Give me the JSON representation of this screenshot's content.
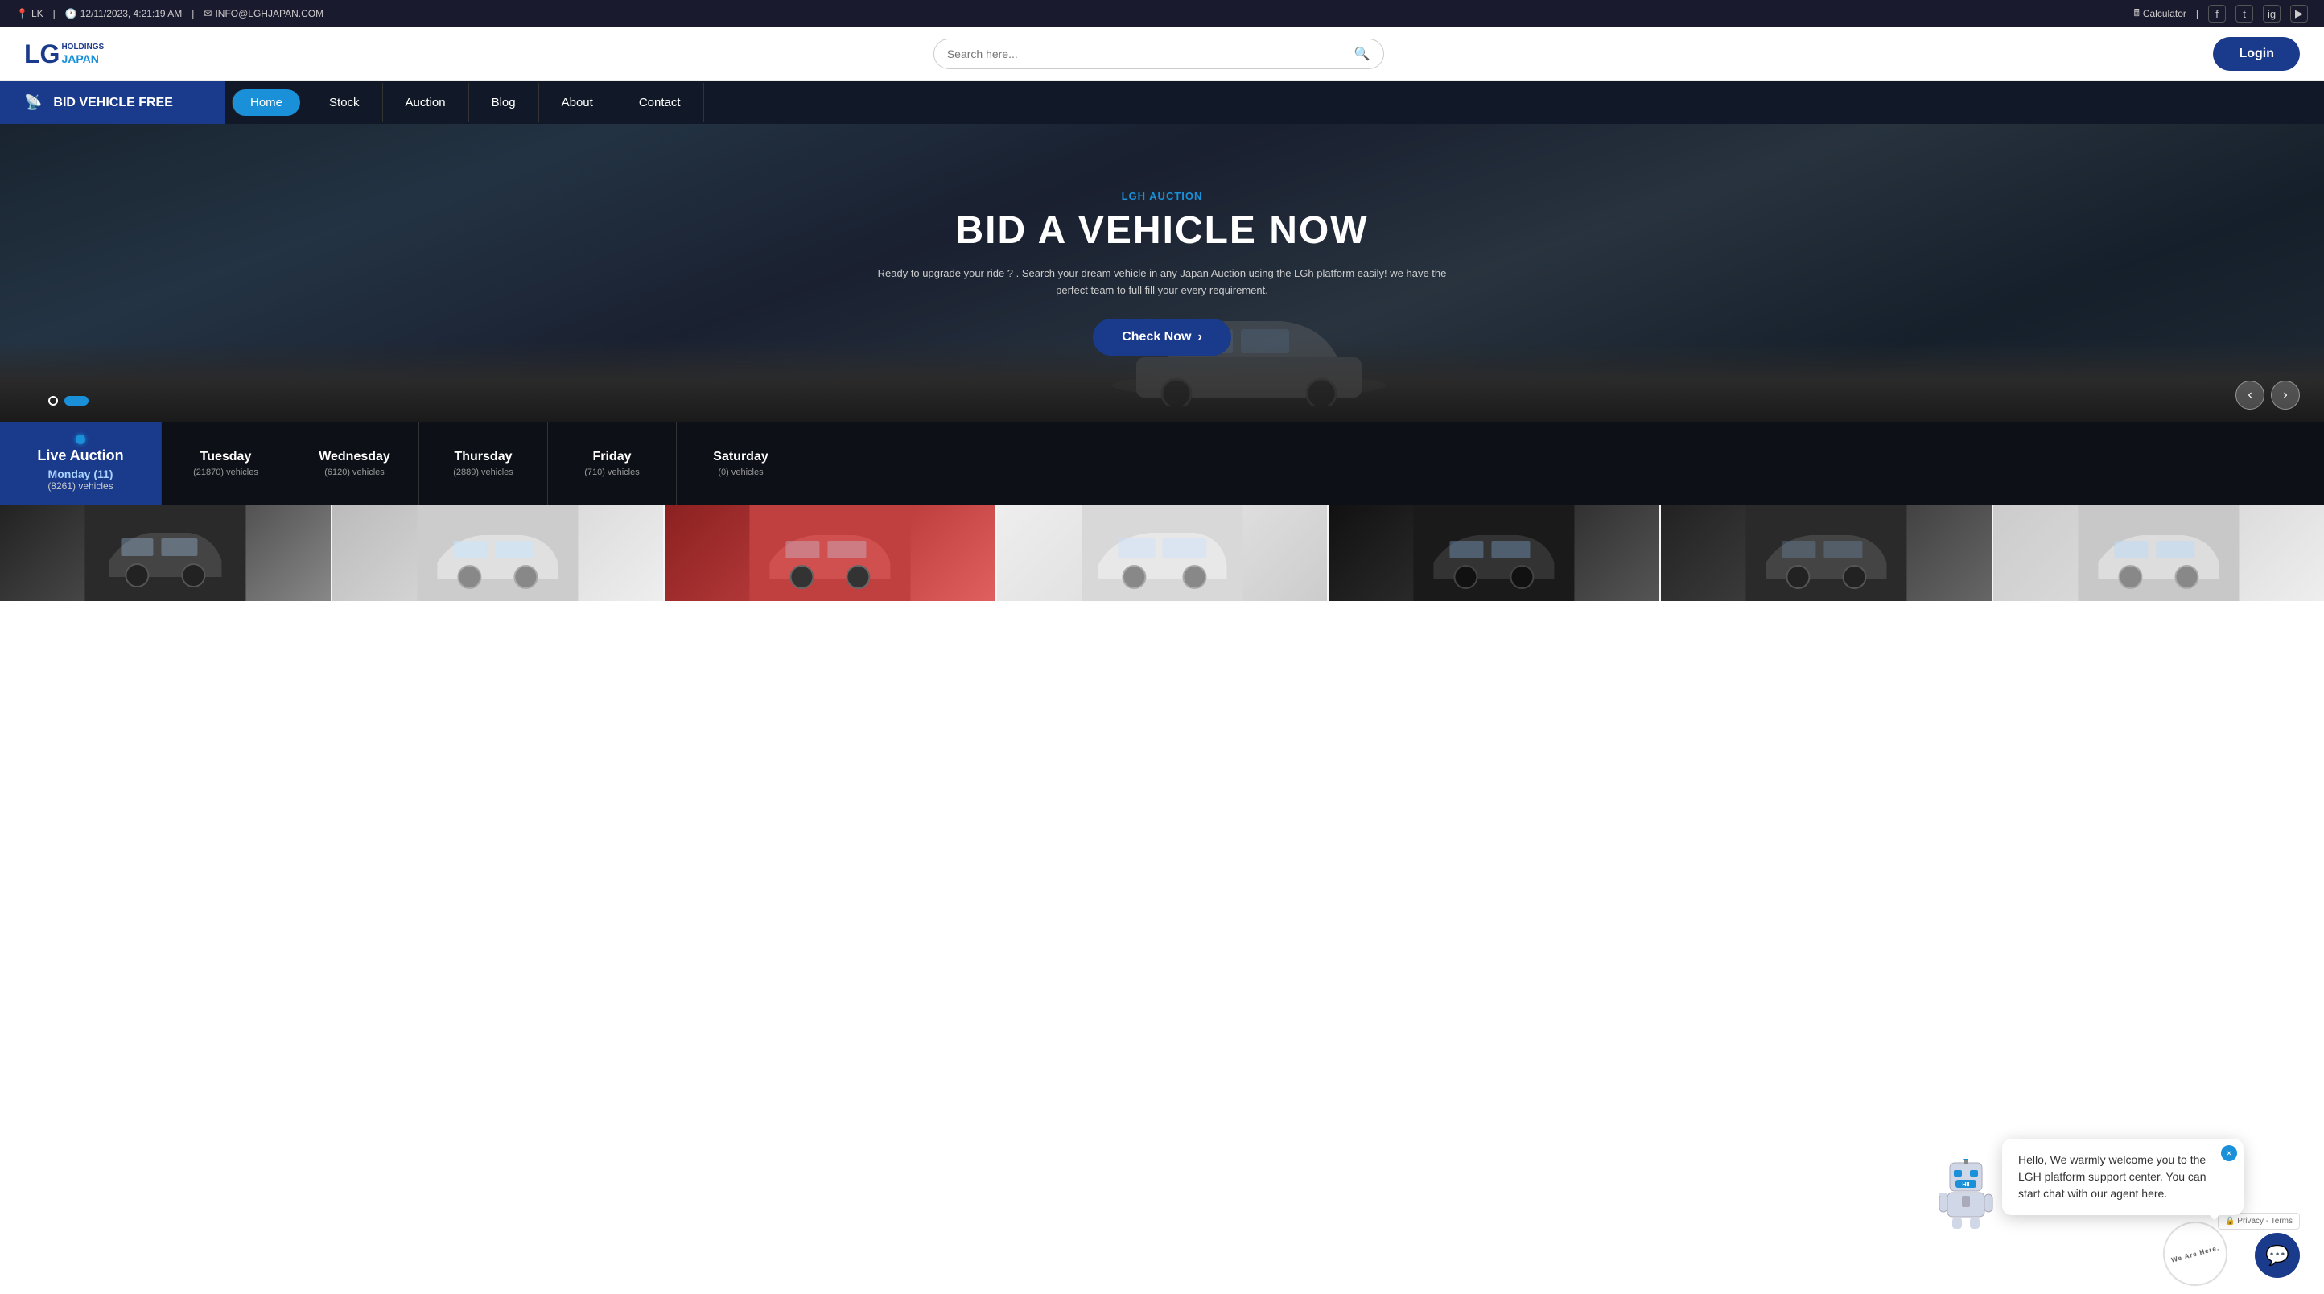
{
  "topbar": {
    "location": "LK",
    "datetime": "12/11/2023, 4:21:19 AM",
    "email": "INFO@LGHJAPAN.COM",
    "calculator": "Calculator",
    "social": [
      "f",
      "t",
      "ig",
      "yt"
    ]
  },
  "header": {
    "logo_lg": "LG",
    "logo_holdings": "HOLDINGS",
    "logo_japan": "JAPAN",
    "search_placeholder": "Search here...",
    "login_label": "Login"
  },
  "nav": {
    "bid_label": "BID VEHICLE FREE",
    "links": [
      {
        "label": "Home",
        "active": true
      },
      {
        "label": "Stock",
        "active": false
      },
      {
        "label": "Auction",
        "active": false
      },
      {
        "label": "Blog",
        "active": false
      },
      {
        "label": "About",
        "active": false
      },
      {
        "label": "Contact",
        "active": false
      }
    ]
  },
  "hero": {
    "subtitle": "LGH AUCTION",
    "title": "BID A VEHICLE NOW",
    "description": "Ready to upgrade your ride ? . Search your dream vehicle in any Japan Auction using the LGh platform easily! we have the perfect team to full fill your every requirement.",
    "cta_label": "Check Now",
    "cta_arrow": "›"
  },
  "slider": {
    "dots": [
      false,
      true
    ],
    "prev_label": "‹",
    "next_label": "›"
  },
  "auction_bar": {
    "live_label": "Live Auction",
    "days": [
      {
        "name": "Monday (11)",
        "vehicles": "(8261) vehicles",
        "active": true
      },
      {
        "name": "Tuesday",
        "vehicles": "(21870) vehicles",
        "active": false
      },
      {
        "name": "Wednesday",
        "vehicles": "(6120) vehicles",
        "active": false
      },
      {
        "name": "Thursday",
        "vehicles": "(2889) vehicles",
        "active": false
      },
      {
        "name": "Friday",
        "vehicles": "(710) vehicles",
        "active": false
      },
      {
        "name": "Saturday",
        "vehicles": "(0) vehicles",
        "active": false
      }
    ]
  },
  "chatbot": {
    "message": "Hello, We warmly welcome you to the LGH platform support center. You can start chat with our agent here.",
    "close_label": "×",
    "we_are_here": "We Are Here.",
    "chat_icon": "💬"
  },
  "recaptcha": {
    "label": "Privacy - Terms"
  }
}
